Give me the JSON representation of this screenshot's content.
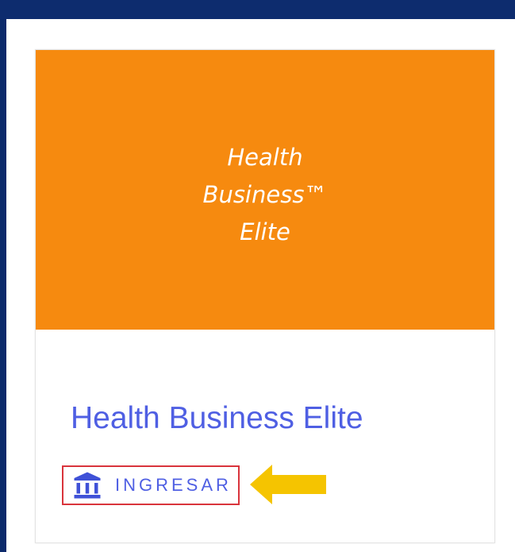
{
  "banner": {
    "lines": [
      "Health",
      "Business™",
      "Elite"
    ],
    "color": "#f68a0f"
  },
  "course": {
    "title": "Health Business Elite",
    "title_color": "#4f5fe3"
  },
  "enter_link": {
    "icon": "bank-icon",
    "label": "INGRESAR",
    "highlight_color": "#d9343c"
  },
  "annotation": {
    "icon": "arrow-left-icon",
    "color": "#f5c400"
  },
  "colors": {
    "background": "#0b2a6b",
    "panel": "#ffffff"
  }
}
